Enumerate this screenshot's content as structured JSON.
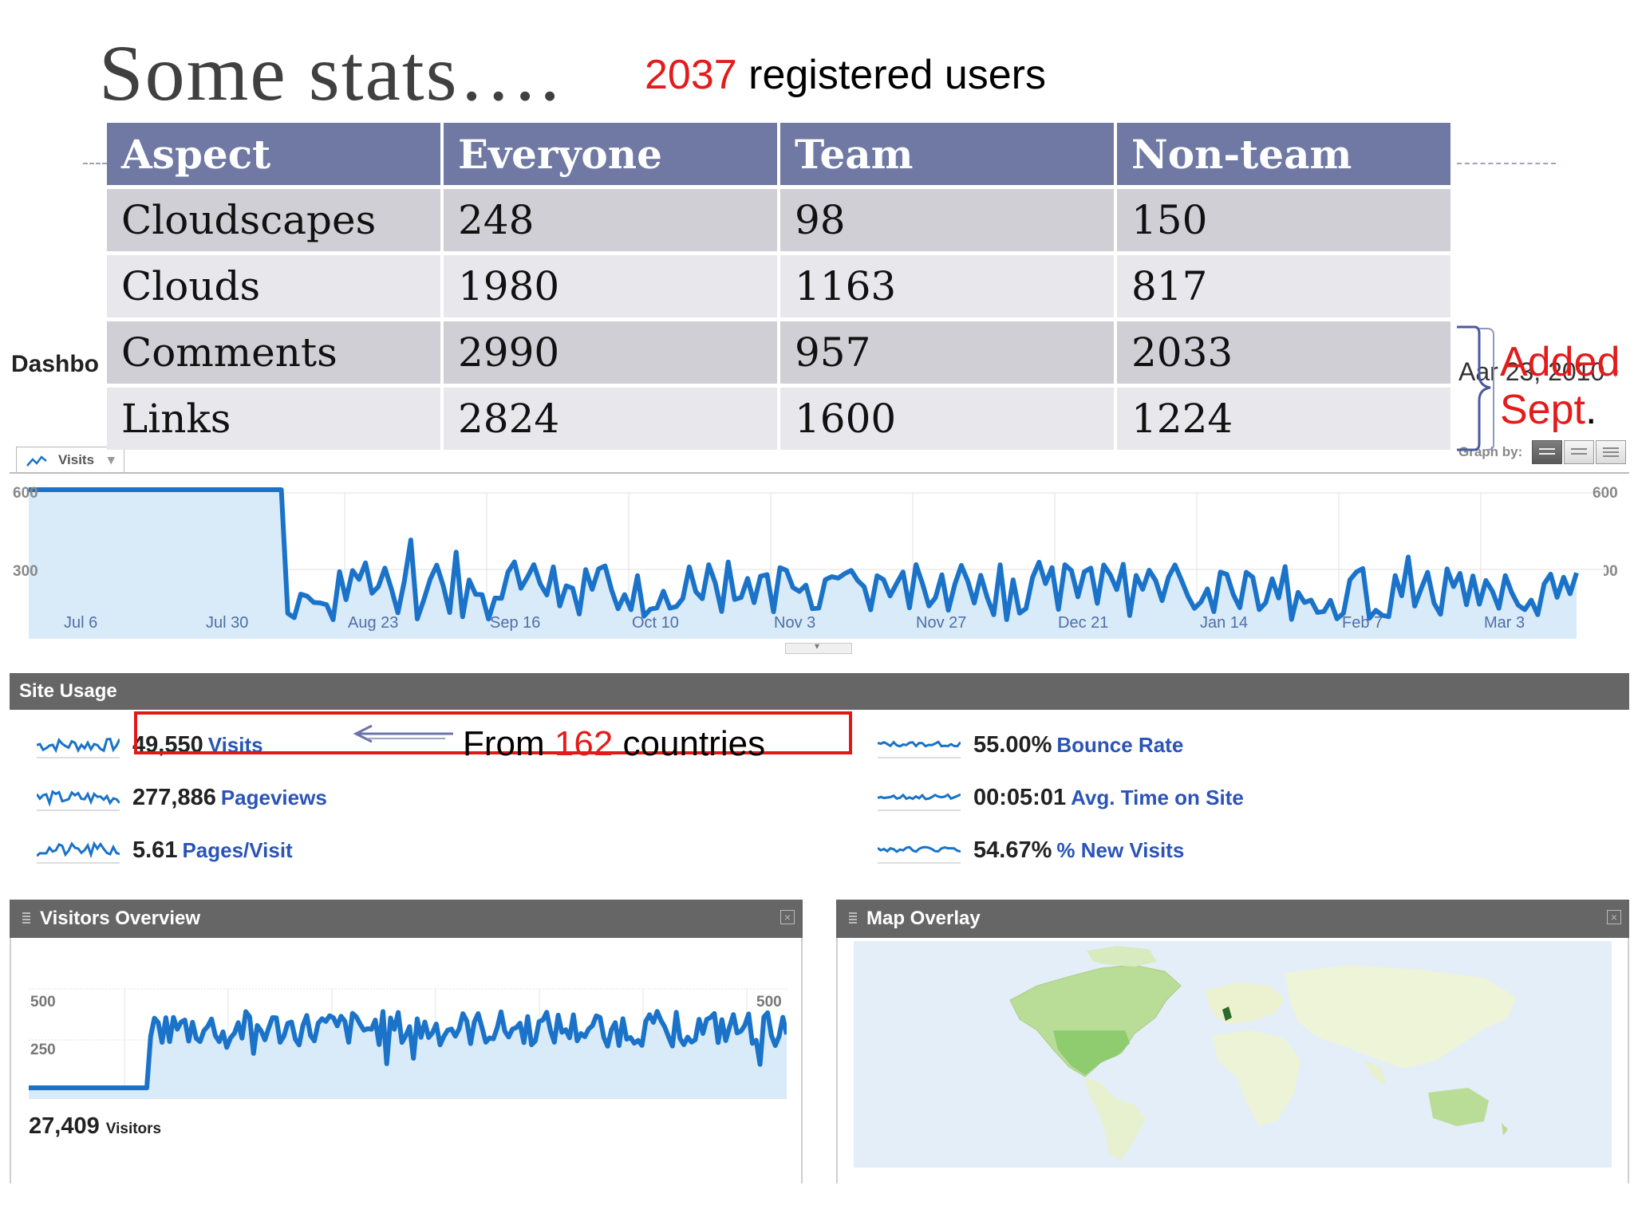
{
  "slide": {
    "title": "Some stats….",
    "registered_count": "2037",
    "registered_label": " registered users"
  },
  "stats_table": {
    "headers": [
      "Aspect",
      "Everyone",
      "Team",
      "Non-team"
    ],
    "rows": [
      [
        "Cloudscapes",
        "248",
        "98",
        "150"
      ],
      [
        "Clouds",
        "1980",
        "1163",
        "817"
      ],
      [
        "Comments",
        "2990",
        "957",
        "2033"
      ],
      [
        "Links",
        "2824",
        "1600",
        "1224"
      ]
    ]
  },
  "added_note": {
    "line1": "Added",
    "line2": "Sept",
    "period": "."
  },
  "dashboard": {
    "title": "Dashbo",
    "date_range_visible": "Aar 23, 2010",
    "graph_by_label": "Graph by:",
    "visits_tab_label": "Visits",
    "y_axis_labels": [
      "600",
      "300"
    ],
    "x_axis_labels": [
      "Jul 6",
      "Jul 30",
      "Aug 23",
      "Sep 16",
      "Oct 10",
      "Nov 3",
      "Nov 27",
      "Dec 21",
      "Jan 14",
      "Feb 7",
      "Mar 3"
    ]
  },
  "site_usage": {
    "title": "Site Usage",
    "metrics_left": [
      {
        "value": "49,550",
        "label": "Visits"
      },
      {
        "value": "277,886",
        "label": "Pageviews"
      },
      {
        "value": "5.61",
        "label": "Pages/Visit"
      }
    ],
    "metrics_right": [
      {
        "value": "55.00%",
        "label": "Bounce Rate"
      },
      {
        "value": "00:05:01",
        "label": "Avg. Time on Site"
      },
      {
        "value": "54.67%",
        "label": "% New Visits"
      }
    ]
  },
  "callout": {
    "prefix": "From ",
    "count": "162",
    "suffix": " countries"
  },
  "visitors_overview": {
    "title": "Visitors Overview",
    "y_labels": [
      "500",
      "250"
    ],
    "total_value": "27,409",
    "total_label": "Visitors"
  },
  "map_overlay": {
    "title": "Map Overlay"
  },
  "colors": {
    "accent_red": "#e31b1b",
    "table_header": "#6f79a3",
    "chart_line": "#1a73c8",
    "chart_fill": "#d9ebf8",
    "metric_label": "#2a54b8",
    "panel_bar": "#666666"
  },
  "icons": [
    "line-chart-icon",
    "dropdown-arrow-icon",
    "calendar-view-icon",
    "table-view-icon",
    "list-view-icon",
    "grip-icon",
    "close-icon",
    "sparkline-icon",
    "left-arrow-icon",
    "brace-icon"
  ]
}
